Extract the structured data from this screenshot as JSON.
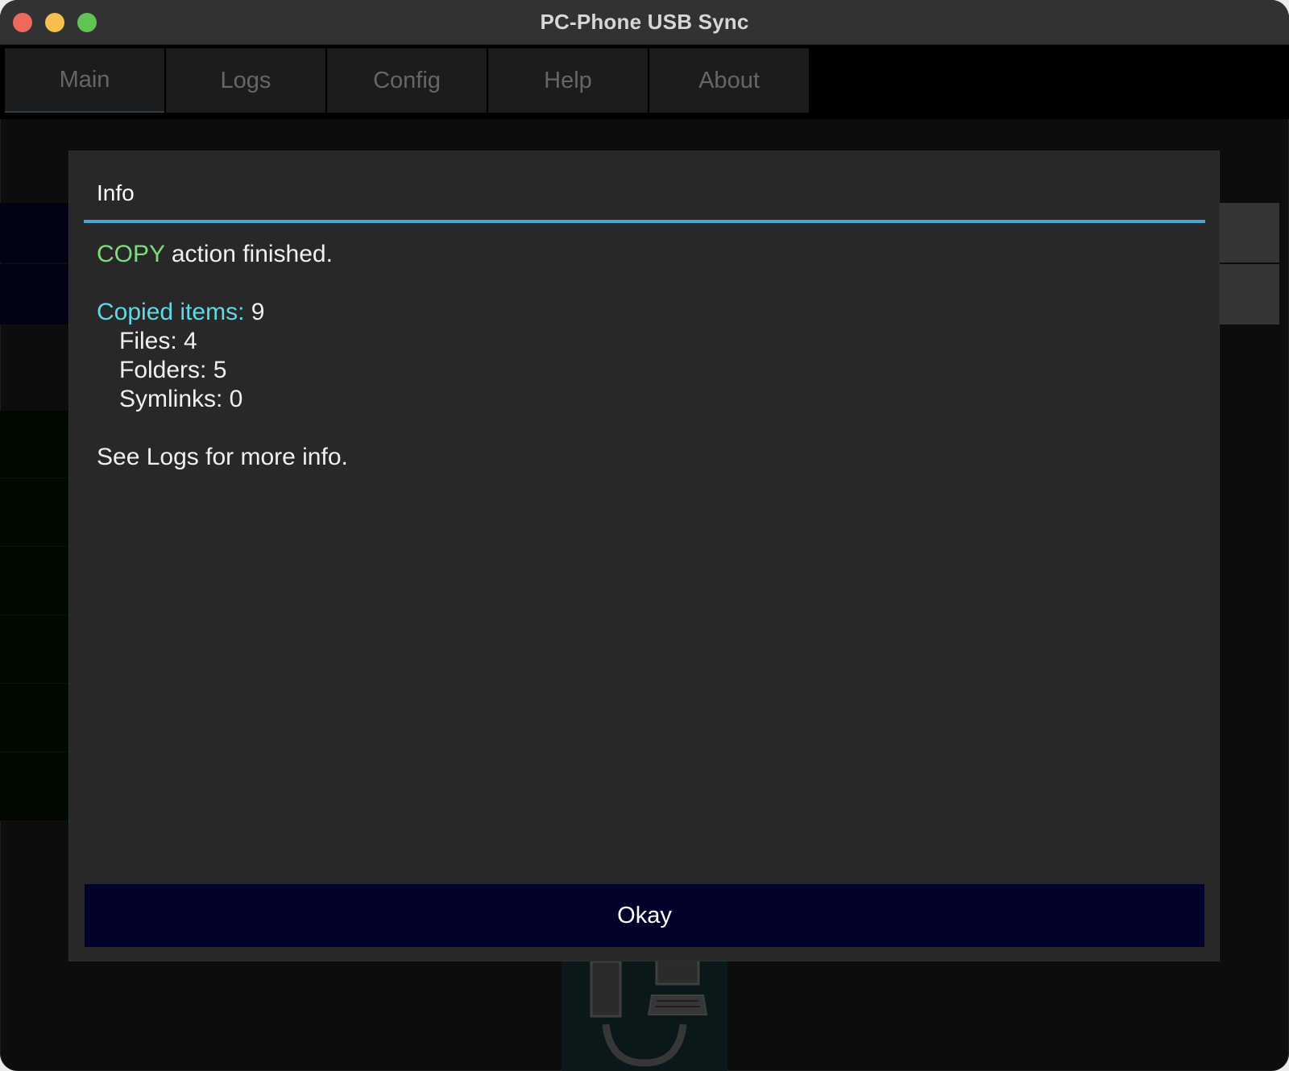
{
  "window": {
    "title": "PC-Phone USB Sync"
  },
  "tabs": [
    {
      "label": "Main",
      "active": true
    },
    {
      "label": "Logs",
      "active": false
    },
    {
      "label": "Config",
      "active": false
    },
    {
      "label": "Help",
      "active": false
    },
    {
      "label": "About",
      "active": false
    }
  ],
  "dialog": {
    "title": "Info",
    "action_name": "COPY",
    "action_suffix": " action finished.",
    "copied_label": "Copied items:",
    "copied_value": " 9",
    "files_text": "Files: 4",
    "folders_text": "Folders: 5",
    "symlinks_text": "Symlinks: 0",
    "footer_text": "See Logs for more info.",
    "ok_label": "Okay"
  },
  "colors": {
    "accent_divider": "#4ea3d8",
    "action_highlight": "#7ddc7d",
    "label_highlight": "#5fd9e8",
    "button_bg": "#01012a"
  }
}
